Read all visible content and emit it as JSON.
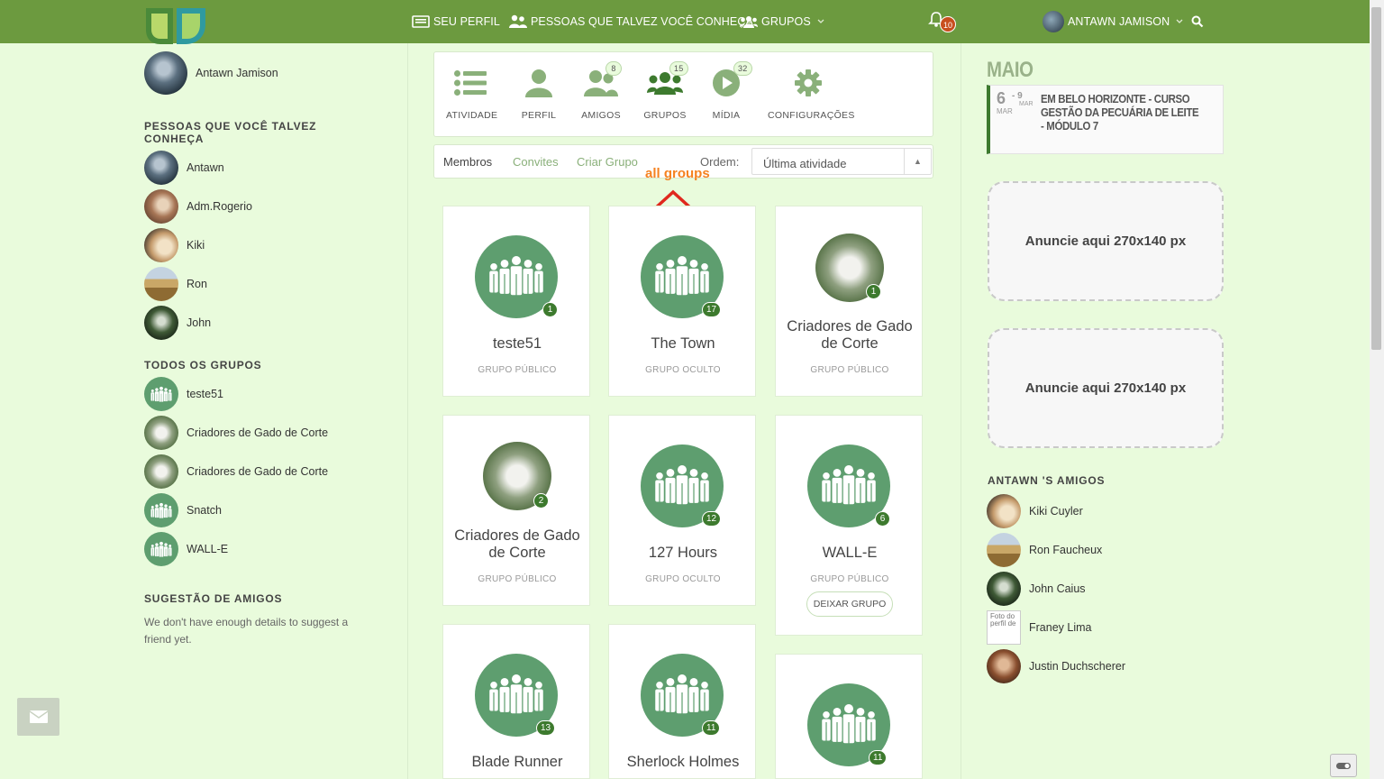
{
  "nav": {
    "profile": "SEU PERFIL",
    "people": "PESSOAS QUE TALVEZ VOCÊ CONHEÇA",
    "groups": "GRUPOS",
    "notifications_count": "10",
    "user_name": "ANTAWN JAMISON"
  },
  "left": {
    "current_user": "Antawn Jamison",
    "people_heading": "PESSOAS QUE VOCÊ TALVEZ CONHEÇA",
    "people": [
      {
        "name": "Antawn",
        "avatar": "av-wolf"
      },
      {
        "name": "Adm.Rogerio",
        "avatar": "av-fox"
      },
      {
        "name": "Kiki",
        "avatar": "av-cat"
      },
      {
        "name": "Ron",
        "avatar": "av-field"
      },
      {
        "name": "John",
        "avatar": "av-tree"
      }
    ],
    "groups_heading": "TODOS OS GRUPOS",
    "groups": [
      {
        "name": "teste51",
        "avatar": "av-group"
      },
      {
        "name": "Criadores de Gado de Corte",
        "avatar": "av-cow"
      },
      {
        "name": "Criadores de Gado de Corte",
        "avatar": "av-cow"
      },
      {
        "name": "Snatch",
        "avatar": "av-group"
      },
      {
        "name": "WALL-E",
        "avatar": "av-group"
      }
    ],
    "suggest_heading": "SUGESTÃO DE AMIGOS",
    "suggest_text": "We don't have enough details to suggest a friend yet."
  },
  "tabs": [
    {
      "label": "ATIVIDADE",
      "icon": "list-icon",
      "badge": ""
    },
    {
      "label": "PERFIL",
      "icon": "user-icon",
      "badge": ""
    },
    {
      "label": "AMIGOS",
      "icon": "friends-icon",
      "badge": "8"
    },
    {
      "label": "GRUPOS",
      "icon": "groups-icon",
      "badge": "15"
    },
    {
      "label": "MÍDIA",
      "icon": "play-icon",
      "badge": "32"
    },
    {
      "label": "CONFIGURAÇÕES",
      "icon": "gear-icon",
      "badge": ""
    }
  ],
  "filter": {
    "members": "Membros",
    "invites": "Convites",
    "create": "Criar Grupo",
    "order_label": "Ordem:",
    "order_value": "Última atividade"
  },
  "annotation": "all groups",
  "groups": [
    {
      "name": "teste51",
      "type": "GRUPO PÚBLICO",
      "count": "1",
      "image": "group"
    },
    {
      "name": "The Town",
      "type": "GRUPO OCULTO",
      "count": "17",
      "image": "group"
    },
    {
      "name": "Criadores de Gado de Corte",
      "type": "GRUPO PÚBLICO",
      "count": "1",
      "image": "cow"
    },
    {
      "name": "Criadores de Gado de Corte",
      "type": "GRUPO PÚBLICO",
      "count": "2",
      "image": "cow"
    },
    {
      "name": "127 Hours",
      "type": "GRUPO OCULTO",
      "count": "12",
      "image": "group"
    },
    {
      "name": "WALL-E",
      "type": "GRUPO PÚBLICO",
      "count": "6",
      "image": "group",
      "action": "DEIXAR GRUPO"
    },
    {
      "name": "Blade Runner",
      "type": "",
      "count": "13",
      "image": "group"
    },
    {
      "name": "Sherlock Holmes",
      "type": "",
      "count": "11",
      "image": "group"
    },
    {
      "name": "",
      "type": "",
      "count": "11",
      "image": "group"
    }
  ],
  "right": {
    "month": "MAIO",
    "event": {
      "day": "6",
      "day_month": "MAR",
      "end": "- 9",
      "end_month": "MAR",
      "title": "EM BELO HORIZONTE - CURSO GESTÃO DA PECUÁRIA DE LEITE - MÓDULO 7"
    },
    "ad1": "Anuncie aqui 270x140 px",
    "ad2": "Anuncie aqui 270x140 px",
    "friends_heading": "ANTAWN 'S AMIGOS",
    "friends": [
      {
        "name": "Kiki Cuyler",
        "avatar": "av-cat"
      },
      {
        "name": "Ron Faucheux",
        "avatar": "av-field"
      },
      {
        "name": "John Caius",
        "avatar": "av-tree"
      },
      {
        "name": "Franey Lima",
        "avatar": "broken"
      },
      {
        "name": "Justin Duchscherer",
        "avatar": "av-dog"
      }
    ],
    "broken_img_alt": "Foto do perfil de"
  },
  "colors": {
    "topbar": "#6c9a3f",
    "background": "#e9fbdc",
    "group_avatar": "#5e9e6f",
    "badge": "#3d7a2e",
    "annotation": "#f58220"
  }
}
